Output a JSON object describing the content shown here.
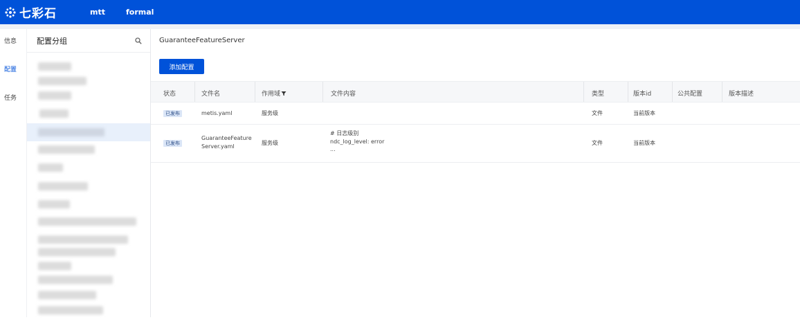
{
  "topbar": {
    "logo_text": "七彩石",
    "nav": [
      "mtt",
      "formal"
    ]
  },
  "leftnav": {
    "items": [
      {
        "label": "信息",
        "active": false
      },
      {
        "label": "配置",
        "active": true
      },
      {
        "label": "任务",
        "active": false
      }
    ]
  },
  "groups": {
    "title": "配置分组",
    "search_icon": "search-icon"
  },
  "main": {
    "server_name": "GuaranteeFeatureServer",
    "add_button": "添加配置",
    "table": {
      "columns": {
        "status": "状态",
        "filename": "文件名",
        "scope": "作用域",
        "content": "文件内容",
        "type": "类型",
        "version_id": "版本id",
        "public": "公共配置",
        "version_desc": "版本描述"
      },
      "rows": [
        {
          "status": "已发布",
          "filename_line1": "metis.yaml",
          "filename_line2": "",
          "scope": "服务级",
          "content_line1": "",
          "content_line2": "",
          "content_line3": "",
          "type": "文件",
          "version_id": "当前版本",
          "public": "",
          "version_desc": ""
        },
        {
          "status": "已发布",
          "filename_line1": "GuaranteeFeature",
          "filename_line2": "Server.yaml",
          "scope": "服务级",
          "content_line1": "# 日志级别",
          "content_line2": "ndc_log_level: error",
          "content_line3": "...",
          "type": "文件",
          "version_id": "当前版本",
          "public": "",
          "version_desc": ""
        }
      ]
    }
  },
  "colors": {
    "brand": "#0052d9",
    "badge_bg": "#dbe6f7"
  }
}
